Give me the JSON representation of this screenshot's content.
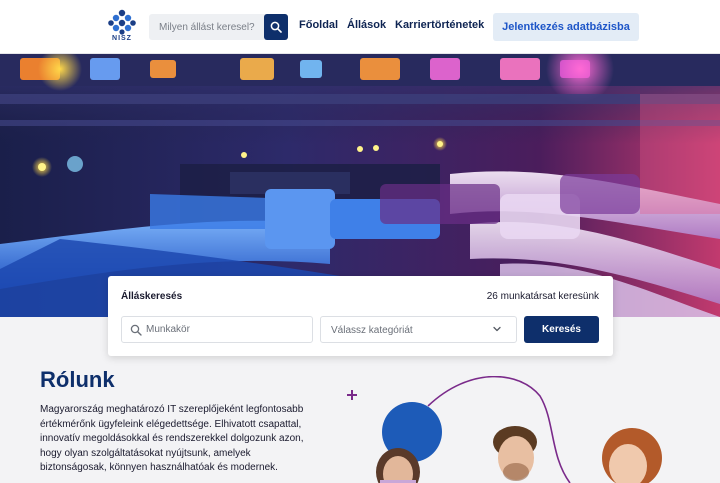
{
  "header": {
    "logo_text": "NISZ",
    "search_placeholder": "Milyen állást keresel?",
    "nav": [
      "Főoldal",
      "Állások",
      "Karriertörténetek"
    ],
    "cta": "Jelentkezés adatbázisba"
  },
  "job_search": {
    "title": "Álláskeresés",
    "count": "26 munkatársat keresünk",
    "job_placeholder": "Munkakör",
    "category_placeholder": "Válassz kategóriát",
    "button": "Keresés"
  },
  "about": {
    "title": "Rólunk",
    "text": "Magyarország meghatározó IT szereplőjeként legfontosabb értékmérőnk ügyfeleink elégedettsége. Elhivatott csapattal, innovatív megoldásokkal és rendszerekkel dolgozunk azon, hogy olyan szolgáltatásokat nyújtsunk, amelyek biztonságosak, könnyen használhatóak és modernek."
  },
  "colors": {
    "brand_dark": "#0e2f6b",
    "brand_blue": "#1e56c8",
    "cta_bg": "#e3ecf6",
    "accent_purple": "#7a2a8a"
  }
}
